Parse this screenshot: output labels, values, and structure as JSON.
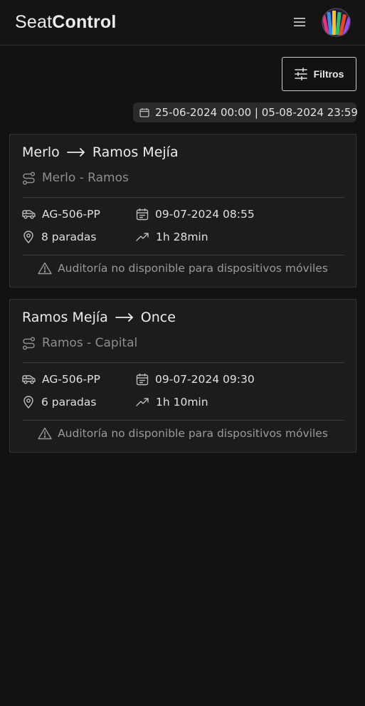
{
  "header": {
    "brand_light": "Seat",
    "brand_bold": "Control"
  },
  "toolbar": {
    "filters_label": "Filtros"
  },
  "date_range": "25-06-2024 00:00 | 05-08-2024 23:59",
  "trips": [
    {
      "origin": "Merlo",
      "destination": "Ramos Mejía",
      "route": "Merlo - Ramos",
      "plate": "AG-506-PP",
      "datetime": "09-07-2024 08:55",
      "stops": "8 paradas",
      "duration": "1h 28min",
      "warning": "Auditoría no disponible para dispositivos móviles"
    },
    {
      "origin": "Ramos Mejía",
      "destination": "Once",
      "route": "Ramos - Capital",
      "plate": "AG-506-PP",
      "datetime": "09-07-2024 09:30",
      "stops": "6 paradas",
      "duration": "1h 10min",
      "warning": "Auditoría no disponible para dispositivos móviles"
    }
  ],
  "colors": {
    "background": "#121212",
    "card": "#1c1c1c",
    "muted": "#8e8e8e"
  }
}
